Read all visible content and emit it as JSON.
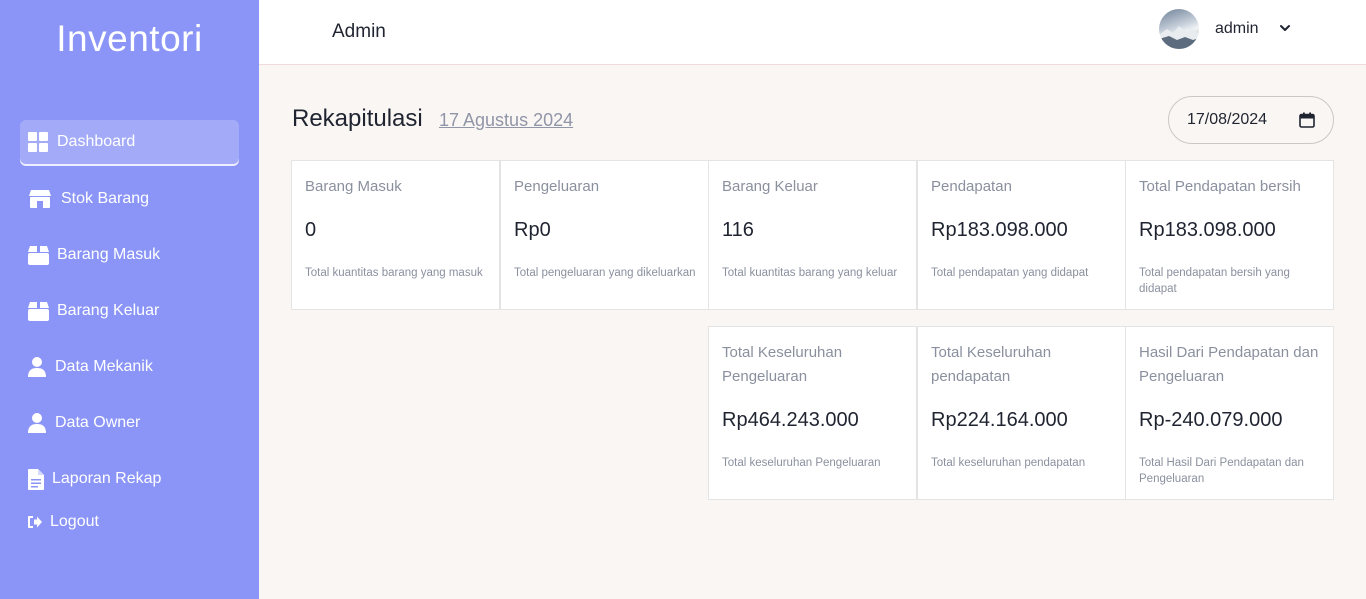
{
  "sidebar": {
    "brand": "Inventori",
    "items": [
      {
        "label": "Dashboard",
        "icon": "dashboard-icon"
      },
      {
        "label": "Stok Barang",
        "icon": "store-icon"
      },
      {
        "label": "Barang Masuk",
        "icon": "box-icon"
      },
      {
        "label": "Barang Keluar",
        "icon": "box-icon"
      },
      {
        "label": "Data Mekanik",
        "icon": "user-icon"
      },
      {
        "label": "Data Owner",
        "icon": "user-icon"
      },
      {
        "label": "Laporan Rekap",
        "icon": "file-icon"
      },
      {
        "label": "Logout",
        "icon": "logout-icon"
      }
    ]
  },
  "header": {
    "title": "Admin",
    "user": "admin"
  },
  "main": {
    "title": "Rekapitulasi",
    "date_label": "17 Agustus 2024",
    "date_input": "17/08/2024",
    "cards": [
      {
        "title": "Barang Masuk",
        "value": "0",
        "desc": "Total kuantitas barang yang masuk"
      },
      {
        "title": "Pengeluaran",
        "value": "Rp0",
        "desc": "Total pengeluaran yang dikeluarkan"
      },
      {
        "title": "Barang Keluar",
        "value": "116",
        "desc": "Total kuantitas barang yang keluar"
      },
      {
        "title": "Pendapatan",
        "value": "Rp183.098.000",
        "desc": "Total pendapatan yang didapat"
      },
      {
        "title": "Total Pendapatan bersih",
        "value": "Rp183.098.000",
        "desc": "Total pendapatan bersih yang didapat"
      },
      {
        "title": "Total Keseluruhan Pengeluaran",
        "value": "Rp464.243.000",
        "desc": "Total keseluruhan Pengeluaran"
      },
      {
        "title": "Total Keseluruhan pendapatan",
        "value": "Rp224.164.000",
        "desc": "Total keseluruhan pendapatan"
      },
      {
        "title": "Hasil Dari Pendapatan dan Pengeluaran",
        "value": "Rp-240.079.000",
        "desc": "Total Hasil Dari Pendapatan dan Pengeluaran"
      }
    ]
  },
  "colors": {
    "sidebar": "#8b95f7",
    "background": "#faf6f3"
  }
}
